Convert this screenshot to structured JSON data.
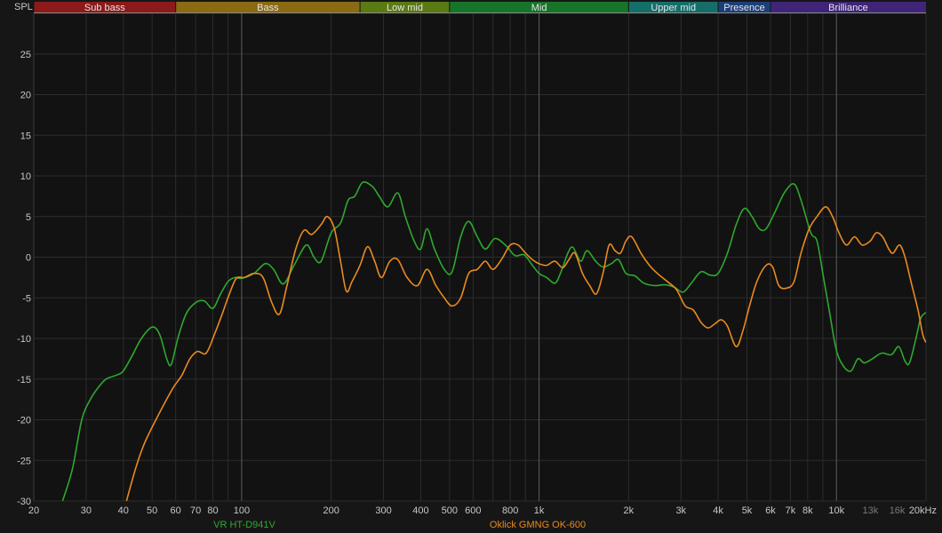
{
  "chart_data": {
    "type": "line",
    "ylabel": "SPL",
    "x_scale": "log",
    "xlim": [
      20,
      20000
    ],
    "ylim": [
      -30,
      30
    ],
    "grid": true,
    "legend_position": "bottom",
    "y_ticks": [
      {
        "v": 25,
        "label": "25"
      },
      {
        "v": 20,
        "label": "20"
      },
      {
        "v": 15,
        "label": "15"
      },
      {
        "v": 10,
        "label": "10"
      },
      {
        "v": 5,
        "label": "5"
      },
      {
        "v": 0,
        "label": "0"
      },
      {
        "v": -5,
        "label": "-5"
      },
      {
        "v": -10,
        "label": "-10"
      },
      {
        "v": -15,
        "label": "-15"
      },
      {
        "v": -20,
        "label": "-20"
      },
      {
        "v": -25,
        "label": "-25"
      },
      {
        "v": -30,
        "label": "-30"
      }
    ],
    "x_ticks": [
      {
        "v": 20,
        "label": "20"
      },
      {
        "v": 30,
        "label": "30"
      },
      {
        "v": 40,
        "label": "40"
      },
      {
        "v": 50,
        "label": "50"
      },
      {
        "v": 60,
        "label": "60"
      },
      {
        "v": 70,
        "label": "70"
      },
      {
        "v": 80,
        "label": "80"
      },
      {
        "v": 100,
        "label": "100"
      },
      {
        "v": 200,
        "label": "200"
      },
      {
        "v": 300,
        "label": "300"
      },
      {
        "v": 400,
        "label": "400"
      },
      {
        "v": 500,
        "label": "500"
      },
      {
        "v": 600,
        "label": "600"
      },
      {
        "v": 800,
        "label": "800"
      },
      {
        "v": 1000,
        "label": "1k"
      },
      {
        "v": 2000,
        "label": "2k"
      },
      {
        "v": 3000,
        "label": "3k"
      },
      {
        "v": 4000,
        "label": "4k"
      },
      {
        "v": 5000,
        "label": "5k"
      },
      {
        "v": 6000,
        "label": "6k"
      },
      {
        "v": 7000,
        "label": "7k"
      },
      {
        "v": 8000,
        "label": "8k"
      },
      {
        "v": 10000,
        "label": "10k"
      },
      {
        "v": 13000,
        "label": "13k",
        "dim": true
      },
      {
        "v": 16000,
        "label": "16k",
        "dim": true
      },
      {
        "v": 20000,
        "label": "20kHz"
      }
    ],
    "major_x_lines": [
      100,
      1000,
      10000
    ],
    "bands": [
      {
        "name": "Sub bass",
        "from": 20,
        "to": 60,
        "color": "#8c1a1a"
      },
      {
        "name": "Bass",
        "from": 60,
        "to": 250,
        "color": "#8a6a12"
      },
      {
        "name": "Low mid",
        "from": 250,
        "to": 500,
        "color": "#5a7a14"
      },
      {
        "name": "Mid",
        "from": 500,
        "to": 2000,
        "color": "#17752a"
      },
      {
        "name": "Upper mid",
        "from": 2000,
        "to": 4000,
        "color": "#156e6a"
      },
      {
        "name": "Presence",
        "from": 4000,
        "to": 6000,
        "color": "#1c3f78"
      },
      {
        "name": "Brilliance",
        "from": 6000,
        "to": 20000,
        "color": "#3f2478"
      }
    ],
    "series": [
      {
        "name": "VR HT-D941V",
        "color": "#2ea82e",
        "points": [
          [
            25,
            -30
          ],
          [
            27,
            -26
          ],
          [
            29,
            -20
          ],
          [
            31,
            -17.5
          ],
          [
            33,
            -16
          ],
          [
            35,
            -15
          ],
          [
            38,
            -14.5
          ],
          [
            40,
            -14
          ],
          [
            43,
            -12
          ],
          [
            46,
            -10
          ],
          [
            50,
            -8.6
          ],
          [
            53,
            -9.5
          ],
          [
            56,
            -12.5
          ],
          [
            58,
            -13.2
          ],
          [
            61,
            -10
          ],
          [
            65,
            -7
          ],
          [
            70,
            -5.6
          ],
          [
            75,
            -5.4
          ],
          [
            80,
            -6.3
          ],
          [
            85,
            -4.5
          ],
          [
            90,
            -3
          ],
          [
            95,
            -2.5
          ],
          [
            100,
            -2.6
          ],
          [
            110,
            -2
          ],
          [
            120,
            -0.8
          ],
          [
            128,
            -1.5
          ],
          [
            138,
            -3.3
          ],
          [
            150,
            -1
          ],
          [
            165,
            1.5
          ],
          [
            175,
            0
          ],
          [
            185,
            -0.5
          ],
          [
            200,
            3
          ],
          [
            215,
            4.2
          ],
          [
            228,
            7
          ],
          [
            240,
            7.5
          ],
          [
            255,
            9.2
          ],
          [
            275,
            8.7
          ],
          [
            290,
            7.5
          ],
          [
            310,
            6.2
          ],
          [
            335,
            7.9
          ],
          [
            355,
            5
          ],
          [
            380,
            2
          ],
          [
            400,
            1
          ],
          [
            420,
            3.5
          ],
          [
            445,
            1
          ],
          [
            480,
            -1.5
          ],
          [
            510,
            -1.8
          ],
          [
            545,
            2.5
          ],
          [
            580,
            4.4
          ],
          [
            620,
            2.5
          ],
          [
            660,
            1
          ],
          [
            710,
            2.3
          ],
          [
            770,
            1.5
          ],
          [
            830,
            0.2
          ],
          [
            890,
            0.3
          ],
          [
            950,
            -1
          ],
          [
            1000,
            -2
          ],
          [
            1060,
            -2.5
          ],
          [
            1130,
            -3.2
          ],
          [
            1180,
            -2
          ],
          [
            1250,
            0.5
          ],
          [
            1300,
            1.2
          ],
          [
            1380,
            -0.5
          ],
          [
            1450,
            0.8
          ],
          [
            1550,
            -0.5
          ],
          [
            1640,
            -1.2
          ],
          [
            1750,
            -0.8
          ],
          [
            1850,
            -0.3
          ],
          [
            1960,
            -2
          ],
          [
            2100,
            -2.3
          ],
          [
            2250,
            -3.2
          ],
          [
            2450,
            -3.5
          ],
          [
            2650,
            -3.4
          ],
          [
            2850,
            -3.7
          ],
          [
            3050,
            -4.3
          ],
          [
            3250,
            -3.2
          ],
          [
            3500,
            -1.8
          ],
          [
            3750,
            -2.2
          ],
          [
            4000,
            -2
          ],
          [
            4300,
            0.5
          ],
          [
            4600,
            4
          ],
          [
            4900,
            6
          ],
          [
            5200,
            5
          ],
          [
            5500,
            3.5
          ],
          [
            5800,
            3.5
          ],
          [
            6200,
            5.5
          ],
          [
            6700,
            8
          ],
          [
            7200,
            9
          ],
          [
            7600,
            7
          ],
          [
            8200,
            3
          ],
          [
            8600,
            2
          ],
          [
            9000,
            -2
          ],
          [
            9500,
            -7
          ],
          [
            10000,
            -11.5
          ],
          [
            10600,
            -13.5
          ],
          [
            11200,
            -14
          ],
          [
            11800,
            -12.5
          ],
          [
            12400,
            -13
          ],
          [
            13200,
            -12.5
          ],
          [
            14200,
            -11.8
          ],
          [
            15300,
            -12
          ],
          [
            16200,
            -11
          ],
          [
            17000,
            -12.8
          ],
          [
            17600,
            -13
          ],
          [
            18500,
            -10
          ],
          [
            19200,
            -7.5
          ],
          [
            20000,
            -6.8
          ]
        ]
      },
      {
        "name": "Oklick GMNG OK-600",
        "color": "#e98a21",
        "points": [
          [
            41,
            -30
          ],
          [
            44,
            -26
          ],
          [
            47,
            -23
          ],
          [
            51,
            -20.3
          ],
          [
            55,
            -18
          ],
          [
            59,
            -16
          ],
          [
            63,
            -14.5
          ],
          [
            67,
            -12.5
          ],
          [
            71,
            -11.6
          ],
          [
            76,
            -11.8
          ],
          [
            81,
            -9.5
          ],
          [
            86,
            -7
          ],
          [
            91,
            -4.5
          ],
          [
            96,
            -2.6
          ],
          [
            102,
            -2.5
          ],
          [
            110,
            -2
          ],
          [
            118,
            -2.5
          ],
          [
            126,
            -5.5
          ],
          [
            134,
            -7
          ],
          [
            142,
            -3.5
          ],
          [
            152,
            1
          ],
          [
            162,
            3.3
          ],
          [
            172,
            2.8
          ],
          [
            185,
            4
          ],
          [
            194,
            5
          ],
          [
            205,
            3.5
          ],
          [
            215,
            -0.5
          ],
          [
            225,
            -4.2
          ],
          [
            235,
            -3
          ],
          [
            250,
            -1
          ],
          [
            265,
            1.3
          ],
          [
            280,
            -0.5
          ],
          [
            295,
            -2.5
          ],
          [
            315,
            -0.5
          ],
          [
            335,
            -0.3
          ],
          [
            360,
            -2.5
          ],
          [
            390,
            -3.5
          ],
          [
            420,
            -1.5
          ],
          [
            450,
            -3.5
          ],
          [
            480,
            -5
          ],
          [
            510,
            -6
          ],
          [
            545,
            -5
          ],
          [
            580,
            -2
          ],
          [
            620,
            -1.5
          ],
          [
            660,
            -0.5
          ],
          [
            700,
            -1.5
          ],
          [
            750,
            -0.2
          ],
          [
            800,
            1.5
          ],
          [
            850,
            1.5
          ],
          [
            900,
            0.5
          ],
          [
            950,
            -0.3
          ],
          [
            1000,
            -0.8
          ],
          [
            1060,
            -1
          ],
          [
            1130,
            -0.5
          ],
          [
            1200,
            -1.3
          ],
          [
            1260,
            -0.3
          ],
          [
            1320,
            0.5
          ],
          [
            1400,
            -2
          ],
          [
            1480,
            -3.5
          ],
          [
            1560,
            -4.5
          ],
          [
            1640,
            -2
          ],
          [
            1720,
            1.5
          ],
          [
            1800,
            0.8
          ],
          [
            1880,
            0.5
          ],
          [
            1960,
            2
          ],
          [
            2050,
            2.5
          ],
          [
            2200,
            0.5
          ],
          [
            2350,
            -1
          ],
          [
            2500,
            -2
          ],
          [
            2700,
            -3
          ],
          [
            2900,
            -4
          ],
          [
            3100,
            -6
          ],
          [
            3300,
            -6.5
          ],
          [
            3500,
            -8
          ],
          [
            3700,
            -8.7
          ],
          [
            3900,
            -8.2
          ],
          [
            4100,
            -7.7
          ],
          [
            4300,
            -8.5
          ],
          [
            4600,
            -11
          ],
          [
            4850,
            -9
          ],
          [
            5100,
            -6
          ],
          [
            5400,
            -3
          ],
          [
            5800,
            -1
          ],
          [
            6100,
            -1.2
          ],
          [
            6400,
            -3.5
          ],
          [
            6800,
            -3.8
          ],
          [
            7200,
            -3
          ],
          [
            7600,
            0.5
          ],
          [
            8100,
            3.5
          ],
          [
            8600,
            5
          ],
          [
            9200,
            6.2
          ],
          [
            9700,
            5
          ],
          [
            10200,
            3
          ],
          [
            10800,
            1.5
          ],
          [
            11500,
            2.5
          ],
          [
            12200,
            1.5
          ],
          [
            13000,
            2
          ],
          [
            13600,
            3
          ],
          [
            14300,
            2.5
          ],
          [
            15000,
            1
          ],
          [
            15500,
            0.5
          ],
          [
            16300,
            1.5
          ],
          [
            17000,
            0
          ],
          [
            17800,
            -3
          ],
          [
            18800,
            -6.5
          ],
          [
            19500,
            -9.5
          ],
          [
            20000,
            -10.5
          ]
        ]
      }
    ]
  }
}
